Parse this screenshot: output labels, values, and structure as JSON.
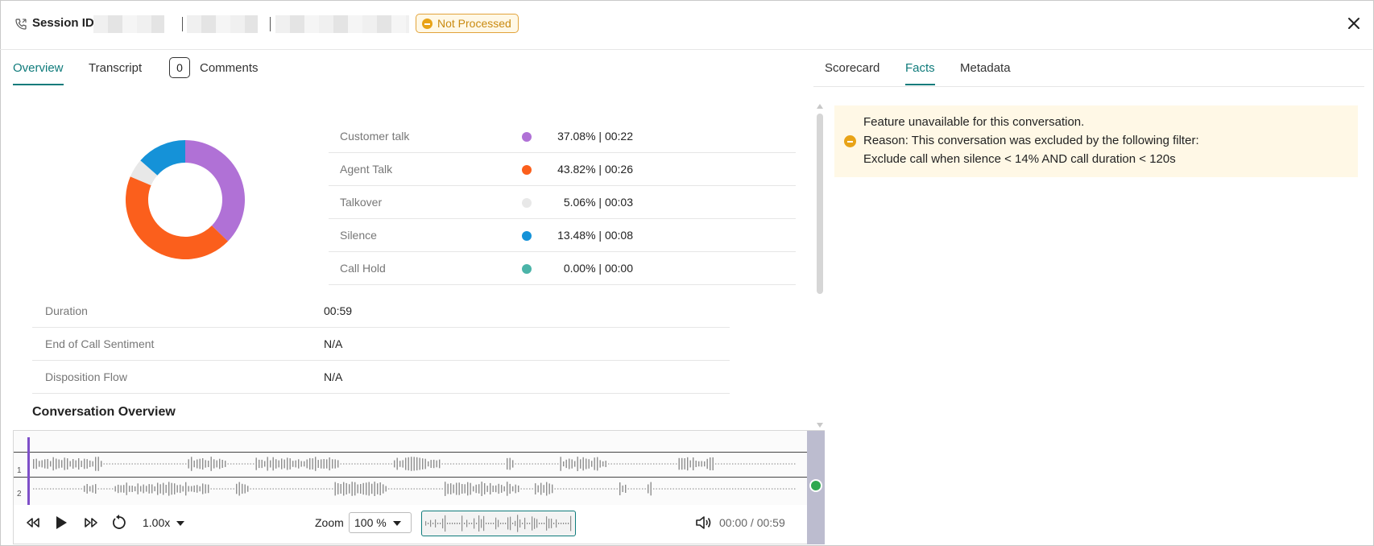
{
  "header": {
    "session_label": "Session ID:",
    "status_badge": "Not Processed"
  },
  "tabs": {
    "left": [
      {
        "label": "Overview",
        "active": true
      },
      {
        "label": "Transcript",
        "active": false
      },
      {
        "label": "Comments",
        "active": false,
        "count": "0"
      }
    ],
    "right": [
      {
        "label": "Scorecard",
        "active": false
      },
      {
        "label": "Facts",
        "active": true
      },
      {
        "label": "Metadata",
        "active": false
      }
    ]
  },
  "talk_stats": [
    {
      "label": "Customer talk",
      "value": "37.08% | 00:22",
      "percent": 37.08,
      "color": "#b071d6"
    },
    {
      "label": "Agent Talk",
      "value": "43.82% | 00:26",
      "percent": 43.82,
      "color": "#fb5f1c"
    },
    {
      "label": "Talkover",
      "value": "5.06% | 00:03",
      "percent": 5.06,
      "color": "#e8e8e8"
    },
    {
      "label": "Silence",
      "value": "13.48% | 00:08",
      "percent": 13.48,
      "color": "#1592d8"
    },
    {
      "label": "Call Hold",
      "value": "0.00% | 00:00",
      "percent": 0.0,
      "color": "#4bb4a8"
    }
  ],
  "info": [
    {
      "label": "Duration",
      "value": "00:59"
    },
    {
      "label": "End of Call Sentiment",
      "value": "N/A"
    },
    {
      "label": "Disposition Flow",
      "value": "N/A"
    }
  ],
  "conversation_overview_title": "Conversation Overview",
  "player": {
    "track_1": "1",
    "track_2": "2",
    "speed": "1.00x",
    "zoom_label": "Zoom",
    "zoom_value": "100 %",
    "time": "00:00 / 00:59"
  },
  "facts_notice": {
    "line1": "Feature unavailable for this conversation.",
    "line2": "Reason: This conversation was excluded by the following filter:",
    "line3": "Exclude call when silence < 14% AND call duration < 120s"
  },
  "colors": {
    "accent": "#0f7b7b",
    "badge": "#e8a317",
    "playhead": "#7e4fc9"
  }
}
